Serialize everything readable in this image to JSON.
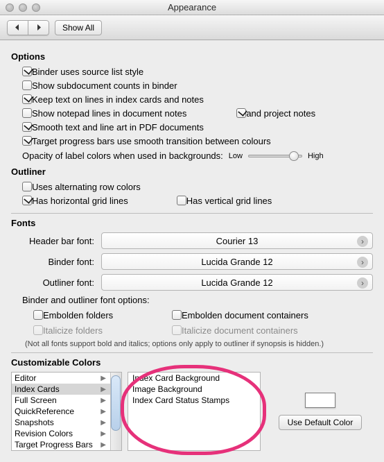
{
  "window": {
    "title": "Appearance"
  },
  "toolbar": {
    "show_all": "Show All"
  },
  "options": {
    "heading": "Options",
    "items": [
      {
        "label": "Binder uses source list style",
        "checked": true
      },
      {
        "label": "Show subdocument counts in binder",
        "checked": false
      },
      {
        "label": "Keep text on lines in index cards and notes",
        "checked": true
      },
      {
        "label": "Show notepad lines in document notes",
        "checked": false,
        "extra": {
          "label": "and project notes",
          "checked": true
        }
      },
      {
        "label": "Smooth text and line art in PDF documents",
        "checked": true
      },
      {
        "label": "Target progress bars use smooth transition between colours",
        "checked": true
      }
    ],
    "opacity": {
      "label": "Opacity of label colors when used in backgrounds:",
      "low": "Low",
      "high": "High",
      "value": 0.75
    }
  },
  "outliner": {
    "heading": "Outliner",
    "items": [
      {
        "label": "Uses alternating row colors",
        "checked": false
      },
      {
        "label": "Has horizontal grid lines",
        "checked": true,
        "extra": {
          "label": "Has vertical grid lines",
          "checked": false
        }
      }
    ]
  },
  "fonts": {
    "heading": "Fonts",
    "rows": [
      {
        "label": "Header bar font:",
        "value": "Courier 13"
      },
      {
        "label": "Binder font:",
        "value": "Lucida Grande 12"
      },
      {
        "label": "Outliner font:",
        "value": "Lucida Grande 12"
      }
    ],
    "binder_options_label": "Binder and outliner font options:",
    "binder_options": [
      {
        "label": "Embolden folders",
        "checked": false,
        "disabled": false
      },
      {
        "label": "Embolden document containers",
        "checked": false,
        "disabled": false
      },
      {
        "label": "Italicize folders",
        "checked": false,
        "disabled": true
      },
      {
        "label": "Italicize document containers",
        "checked": false,
        "disabled": true
      }
    ],
    "note": "(Not all fonts support bold and italics; options only apply to outliner if synopsis is hidden.)"
  },
  "colors": {
    "heading": "Customizable Colors",
    "categories": [
      "Editor",
      "Index Cards",
      "Full Screen",
      "QuickReference",
      "Snapshots",
      "Revision Colors",
      "Target Progress Bars"
    ],
    "selected_category_index": 1,
    "subitems": [
      "Index Card Background",
      "Image Background",
      "Index Card Status Stamps"
    ],
    "swatch_hex": "#ffffff",
    "default_btn": "Use Default Color"
  }
}
